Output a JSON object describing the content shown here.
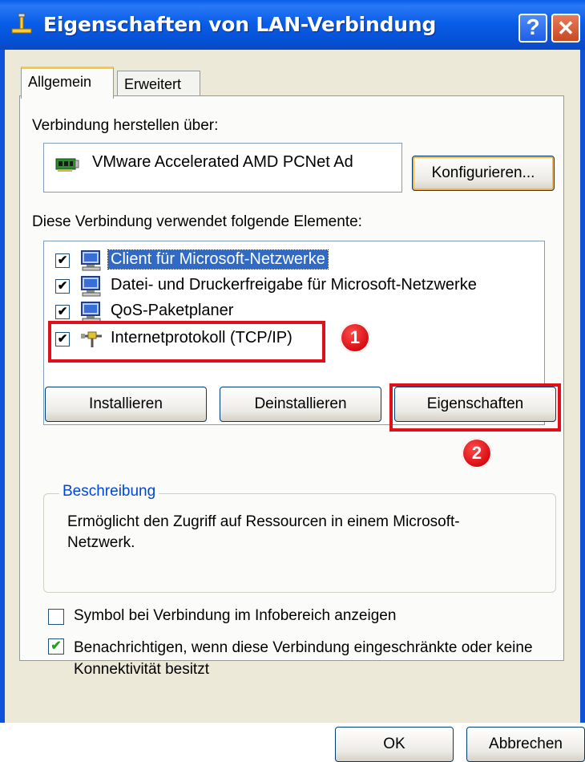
{
  "window": {
    "title": "Eigenschaften von LAN-Verbindung",
    "help_glyph": "?",
    "close_glyph": "✕",
    "title_icon": "network-connection-icon"
  },
  "tabs": [
    {
      "label": "Allgemein",
      "active": true
    },
    {
      "label": "Erweitert",
      "active": false
    }
  ],
  "connect_via": {
    "label": "Verbindung herstellen über:",
    "adapter": "VMware Accelerated AMD PCNet Ad",
    "adapter_icon": "network-card-icon",
    "configure_button": "Konfigurieren..."
  },
  "elements": {
    "label": "Diese Verbindung verwendet folgende Elemente:",
    "items": [
      {
        "label": "Client für Microsoft-Netzwerke",
        "checked": true,
        "selected": true,
        "icon": "computer-network-icon"
      },
      {
        "label": "Datei- und Druckerfreigabe für Microsoft-Netzwerke",
        "checked": true,
        "selected": false,
        "icon": "computer-network-icon"
      },
      {
        "label": "QoS-Paketplaner",
        "checked": true,
        "selected": false,
        "icon": "computer-network-icon"
      },
      {
        "label": "Internetprotokoll (TCP/IP)",
        "checked": true,
        "selected": false,
        "icon": "protocol-icon"
      }
    ],
    "check_glyph": "✔"
  },
  "buttons": {
    "install": "Installieren",
    "uninstall": "Deinstallieren",
    "properties": "Eigenschaften",
    "ok": "OK",
    "cancel": "Abbrechen"
  },
  "description": {
    "legend": "Beschreibung",
    "text": "Ermöglicht den Zugriff auf Ressourcen in einem Microsoft-Netzwerk."
  },
  "options": [
    {
      "label": "Symbol bei Verbindung im Infobereich anzeigen",
      "checked": false
    },
    {
      "label": "Benachrichtigen, wenn diese Verbindung eingeschränkte oder keine Konnektivität besitzt",
      "checked": true,
      "glyph": "✔"
    }
  ],
  "annotations": {
    "marker_1": "1",
    "marker_2": "2",
    "color": "#e0101a"
  }
}
